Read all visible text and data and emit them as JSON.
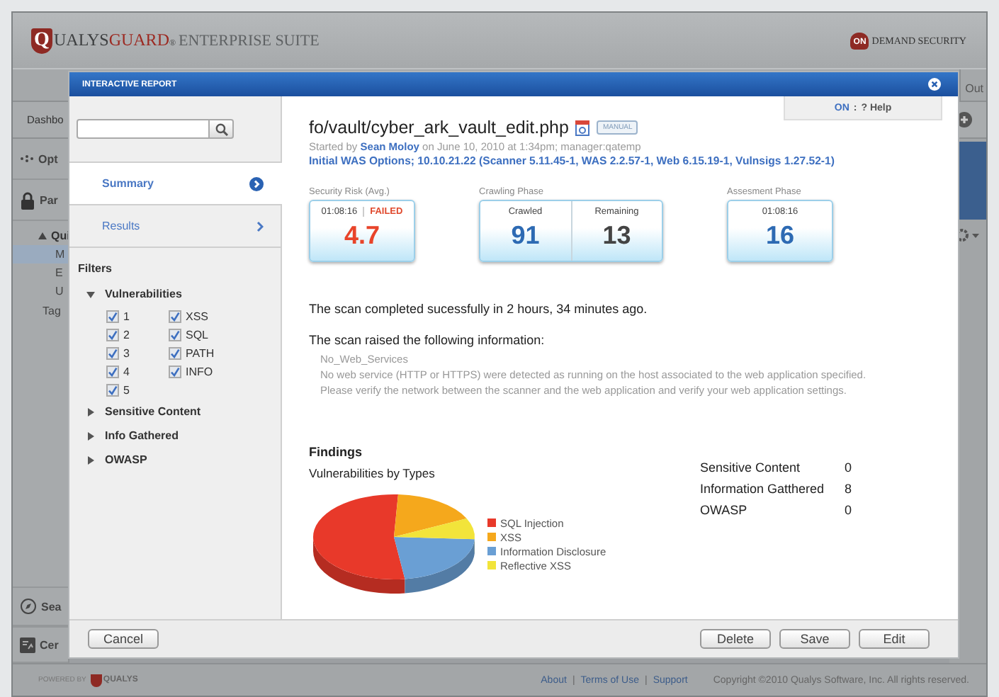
{
  "app": {
    "logo": {
      "parts": [
        {
          "text": "Q",
          "kind": "shield"
        },
        {
          "text": "UALYS",
          "kind": "dark"
        },
        {
          "text": "GUARD",
          "kind": "accent"
        },
        {
          "text": "®",
          "kind": "mark"
        },
        {
          "text": "ENTERPRISE SUITE",
          "kind": "light"
        }
      ]
    },
    "partner_logo": {
      "badge": "ON",
      "text": "DEMAND SECURITY"
    },
    "nav": {
      "logout": "Out"
    },
    "toolbar": {
      "tab": "Dashbo"
    },
    "sidebar": {
      "items": [
        {
          "label": "Opt",
          "kind": "options"
        },
        {
          "label": "Par",
          "kind": "lock"
        },
        {
          "label": "Qui",
          "kind": "group",
          "expanded": true,
          "children": [
            {
              "label": "M",
              "selected": true
            },
            {
              "label": "E",
              "selected": false
            },
            {
              "label": "U",
              "selected": false
            }
          ]
        },
        {
          "label": "Tag",
          "kind": "plain"
        }
      ],
      "bottom_items": [
        {
          "label": "Sea",
          "kind": "compass"
        },
        {
          "label": "Cer",
          "kind": "certificate"
        }
      ]
    },
    "footer": {
      "powered_by": "POWERED BY",
      "brand": "QUALYS",
      "links": [
        {
          "label": "About"
        },
        {
          "label": "Terms of Use"
        },
        {
          "label": "Support"
        }
      ],
      "separators": [
        "|",
        "|"
      ],
      "copyright": "Copyright ©2010 Qualys Software, Inc. All rights reserved."
    }
  },
  "report": {
    "title": "INTERACTIVE REPORT",
    "nav": [
      {
        "label": "Summary",
        "selected": true
      },
      {
        "label": "Results",
        "selected": false
      }
    ],
    "filters": {
      "title": "Filters",
      "groups": [
        {
          "label": "Vulnerabilities",
          "expanded": true,
          "options": [
            {
              "label": "1",
              "checked": true
            },
            {
              "label": "XSS",
              "checked": true
            },
            {
              "label": "2",
              "checked": true
            },
            {
              "label": "SQL",
              "checked": true
            },
            {
              "label": "3",
              "checked": true
            },
            {
              "label": "PATH",
              "checked": true
            },
            {
              "label": "4",
              "checked": true
            },
            {
              "label": "INFO",
              "checked": true
            },
            {
              "label": "5",
              "checked": true
            }
          ]
        },
        {
          "label": "Sensitive Content",
          "expanded": false
        },
        {
          "label": "Info Gathered",
          "expanded": false
        },
        {
          "label": "OWASP",
          "expanded": false
        }
      ]
    },
    "help": {
      "status": "ON",
      "separator": ":",
      "label": "? Help"
    },
    "page": "fo/vault/cyber_ark_vault_edit.php",
    "badge": "MANUAL",
    "started_by": {
      "prefix": "Started by",
      "author": "Sean Moloy",
      "suffix": "on June 10, 2010 at 1:34pm; manager:qatemp"
    },
    "options": "Initial WAS Options; 10.10.21.22 (Scanner 5.11.45-1, WAS 2.2.57-1, Web 6.15.19-1, Vulnsigs 1.27.52-1)",
    "stats": [
      {
        "kind": "risk",
        "label": "Security Risk (Avg.)",
        "time": "01:08:16",
        "status": "FAILED",
        "value": "4.7"
      },
      {
        "kind": "split",
        "label": "Crawling Phase",
        "columns": [
          {
            "label": "Crawled",
            "value": "91"
          },
          {
            "label": "Remaining",
            "value": "13"
          }
        ]
      },
      {
        "kind": "timed",
        "label": "Assesment Phase",
        "time": "01:08:16",
        "value": "16"
      }
    ],
    "messages": [
      "The scan completed sucessfully in 2 hours, 34 minutes ago.",
      "The scan raised the following information:"
    ],
    "notice": {
      "title": "No_Web_Services",
      "lines": [
        "No web service (HTTP or HTTPS) were detected as running on the host associated to the web application specified.",
        "Please verify the network between the scanner and the web application and verify your web application settings."
      ]
    },
    "findings": {
      "title": "Findings",
      "chart_title": "Vulnerabilities by Types",
      "legend": [
        {
          "label": "SQL Injection",
          "color": "#e8392a"
        },
        {
          "label": "XSS",
          "color": "#f5a81c"
        },
        {
          "label": "Information Disclosure",
          "color": "#6a9fd4"
        },
        {
          "label": "Reflective XSS",
          "color": "#f2e43a"
        }
      ],
      "totals": [
        {
          "label": "Sensitive Content",
          "value": "0"
        },
        {
          "label": "Information Gatthered",
          "value": "8"
        },
        {
          "label": "OWASP",
          "value": "0"
        }
      ]
    },
    "footer": {
      "cancel": "Cancel",
      "actions": [
        "Delete",
        "Save",
        "Edit"
      ]
    }
  }
}
